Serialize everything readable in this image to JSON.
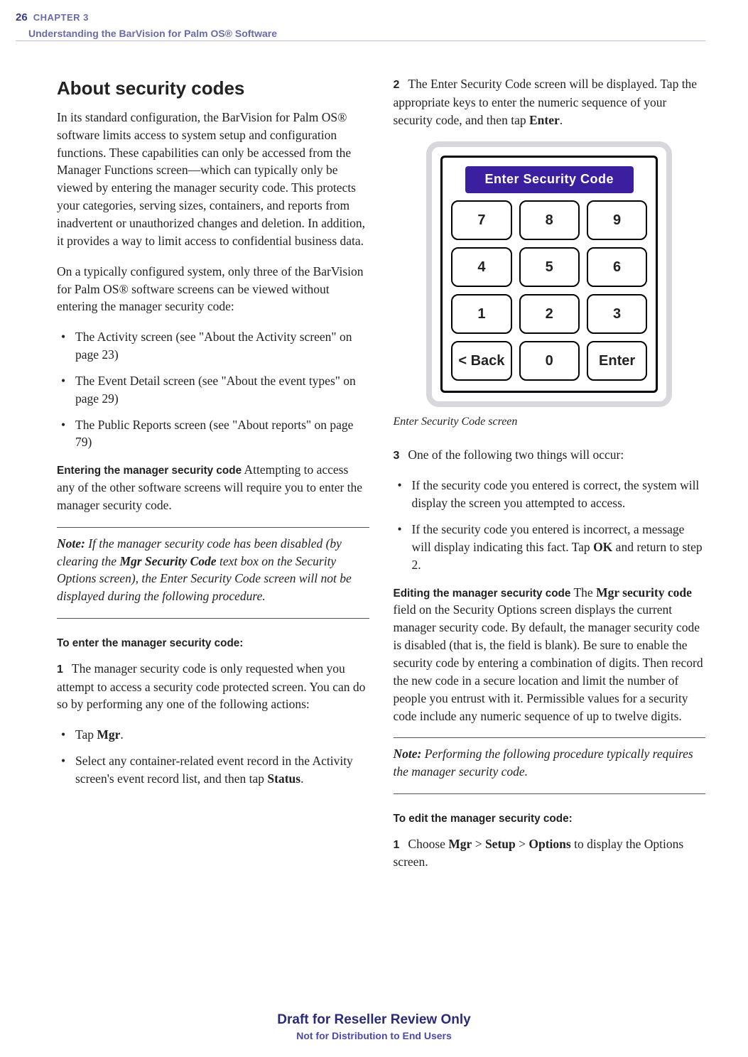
{
  "header": {
    "page_number": "26",
    "chapter_label": "CHAPTER 3",
    "chapter_title": "Understanding the BarVision for Palm OS® Software"
  },
  "left": {
    "heading": "About security codes",
    "p1": "In its standard configuration, the BarVision for Palm OS® software limits access to system setup and configuration functions. These capabilities can only be accessed from the Manager Functions screen—which can typically only be viewed by entering the manager security code. This protects your categories, serving sizes, containers, and reports from inadvertent or unauthorized changes and deletion. In addition, it provides a way to limit access to confidential business data.",
    "p2": "On a typically configured system, only three of the BarVision for Palm OS® software screens can be viewed without entering the manager security code:",
    "bullets1": [
      "The Activity screen (see \"About the Activity screen\" on page 23)",
      "The Event Detail screen (see \"About the event types\" on page 29)",
      "The Public Reports screen (see \"About reports\" on page 79)"
    ],
    "runin1_head": "Entering the manager security code",
    "runin1_body": "  Attempting to access any of the other software screens will require you to enter the manager security code.",
    "note_prefix": "Note:",
    "note_body_a": " If the manager security code has been disabled (by clearing the ",
    "note_bold": "Mgr Security Code",
    "note_body_b": " text box on the Security Options screen), the Enter Security Code screen will not be displayed during the following procedure.",
    "proc1_head": "To enter the manager security code:",
    "step1_num": "1",
    "step1_body": "The manager security code is only requested when you attempt to access a security code protected screen. You can do so by performing any one of the following actions:",
    "step1_bullets": {
      "b1a": "Tap ",
      "b1b": "Mgr",
      "b1c": ".",
      "b2a": "Select any container-related event record in the Activity screen's event record list, and then tap ",
      "b2b": "Status",
      "b2c": "."
    }
  },
  "right": {
    "step2_num": "2",
    "step2_body_a": "The Enter Security Code screen will be displayed. Tap the appropriate keys to enter the numeric sequence of your security code, and then tap ",
    "step2_body_b": "Enter",
    "step2_body_c": ".",
    "figure": {
      "title": "Enter Security Code",
      "keys": [
        "7",
        "8",
        "9",
        "4",
        "5",
        "6",
        "1",
        "2",
        "3",
        "< Back",
        "0",
        "Enter"
      ],
      "caption": "Enter Security Code screen"
    },
    "step3_num": "3",
    "step3_body": "One of the following two things will occur:",
    "step3_bullets": {
      "b1": "If the security code you entered is correct, the system will display the screen you attempted to access.",
      "b2a": "If the security code you entered is incorrect, a message will display indicating this fact. Tap ",
      "b2b": "OK",
      "b2c": " and return to step 2."
    },
    "runin2_head": "Editing the manager security code",
    "runin2_body_a": "  The ",
    "runin2_bold": "Mgr security code",
    "runin2_body_b": " field on the Security Options screen displays the current manager security code. By default, the manager security code is disabled (that is, the field is blank). Be sure to enable the security code by entering a combination of digits. Then record the new code in a secure location and limit the number of people you entrust with it. Permissible values for a security code include any numeric sequence of up to twelve digits.",
    "note2_prefix": "Note:",
    "note2_body": " Performing the following procedure typically requires the manager security code.",
    "proc2_head": "To edit the manager security code:",
    "step4_num": "1",
    "step4_a": "Choose ",
    "step4_b": "Mgr",
    "step4_c": " > ",
    "step4_d": "Setup",
    "step4_e": " > ",
    "step4_f": "Options",
    "step4_g": " to display the Options screen."
  },
  "footer": {
    "line1": "Draft for Reseller Review Only",
    "line2": "Not for Distribution to End Users"
  }
}
